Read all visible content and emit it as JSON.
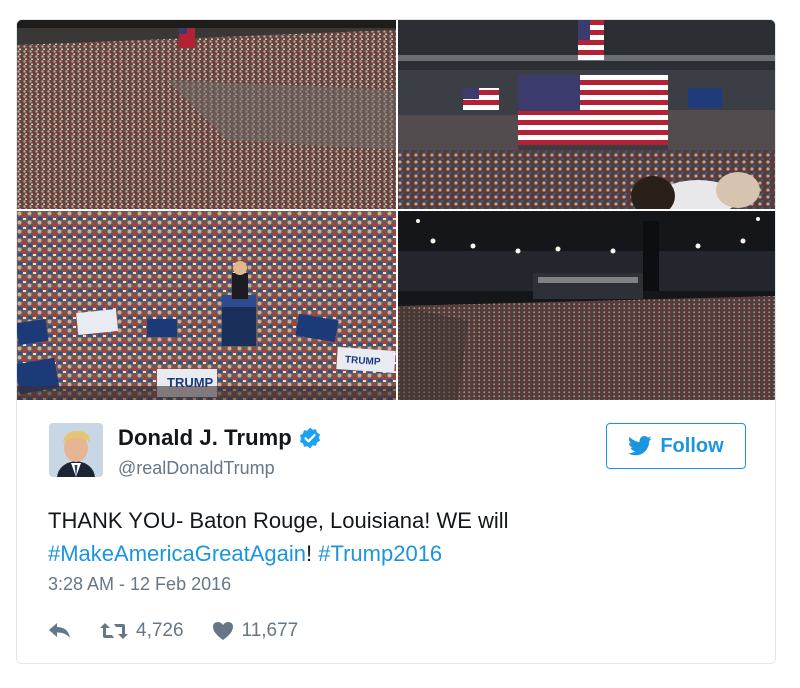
{
  "media": {
    "photos": [
      {
        "name": "rally-photo-arena-wide"
      },
      {
        "name": "rally-photo-stage-flag"
      },
      {
        "name": "rally-photo-podium-signs"
      },
      {
        "name": "rally-photo-arena-lights"
      }
    ],
    "sign_text": "TRUMP"
  },
  "user": {
    "display_name": "Donald J. Trump",
    "handle": "@realDonaldTrump",
    "verified": true
  },
  "follow_button": {
    "label": "Follow",
    "icon": "twitter-bird-icon"
  },
  "tweet": {
    "text_part1": "THANK YOU- Baton Rouge, Louisiana! WE will ",
    "hashtag1": "#MakeAmericaGreatAgain",
    "text_part2": "! ",
    "hashtag2": "#Trump2016"
  },
  "timestamp": "3:28 AM - 12 Feb 2016",
  "actions": {
    "reply": {
      "icon": "reply-icon"
    },
    "retweet": {
      "icon": "retweet-icon",
      "count": "4,726"
    },
    "like": {
      "icon": "heart-icon",
      "count": "11,677"
    }
  },
  "colors": {
    "link": "#1b95e0",
    "muted": "#657786",
    "text": "#14171a",
    "border": "#e1e8ed"
  }
}
